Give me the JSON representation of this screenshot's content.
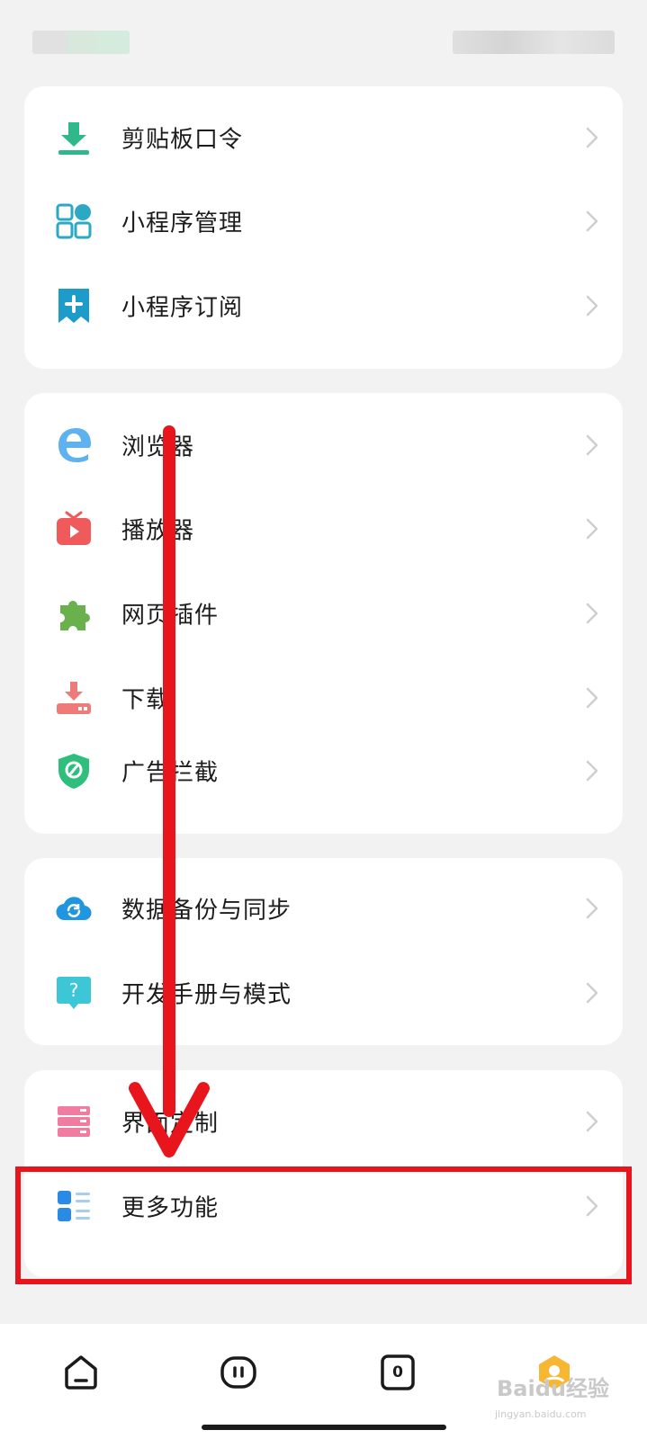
{
  "sections": [
    {
      "items": [
        {
          "label": "剪贴板口令",
          "icon": "download-icon",
          "color": "#2fb889"
        },
        {
          "label": "小程序管理",
          "icon": "grid-apps-icon",
          "color": "#2aa8c4"
        },
        {
          "label": "小程序订阅",
          "icon": "bookmark-plus-icon",
          "color": "#1d9bc9"
        }
      ]
    },
    {
      "items": [
        {
          "label": "浏览器",
          "icon": "browser-e-icon",
          "color": "#5fb2f0"
        },
        {
          "label": "播放器",
          "icon": "tv-play-icon",
          "color": "#ef5b5b"
        },
        {
          "label": "网页插件",
          "icon": "puzzle-icon",
          "color": "#6ab04c"
        },
        {
          "label": "下载",
          "icon": "download-tray-icon",
          "color": "#ef7a7a"
        },
        {
          "label": "广告拦截",
          "icon": "shield-block-icon",
          "color": "#2dbf7b"
        }
      ]
    },
    {
      "items": [
        {
          "label": "数据备份与同步",
          "icon": "cloud-sync-icon",
          "color": "#2196e0"
        },
        {
          "label": "开发手册与模式",
          "icon": "help-bubble-icon",
          "color": "#3cc6d6"
        }
      ]
    },
    {
      "items": [
        {
          "label": "界面定制",
          "icon": "layout-icon",
          "color": "#f07ca0"
        },
        {
          "label": "更多功能",
          "icon": "list-more-icon",
          "color": "#2a8be6"
        }
      ]
    }
  ],
  "bottom_nav": [
    {
      "icon": "home-icon"
    },
    {
      "icon": "face-tab-icon"
    },
    {
      "icon": "tab-count-icon",
      "count": "0"
    },
    {
      "icon": "profile-hex-icon"
    }
  ],
  "watermark": {
    "brand": "Baidu经验",
    "sub": "jingyan.baidu.com"
  },
  "colors": {
    "annotation": "#e8161c",
    "background": "#f2f2f2",
    "card": "#ffffff"
  }
}
